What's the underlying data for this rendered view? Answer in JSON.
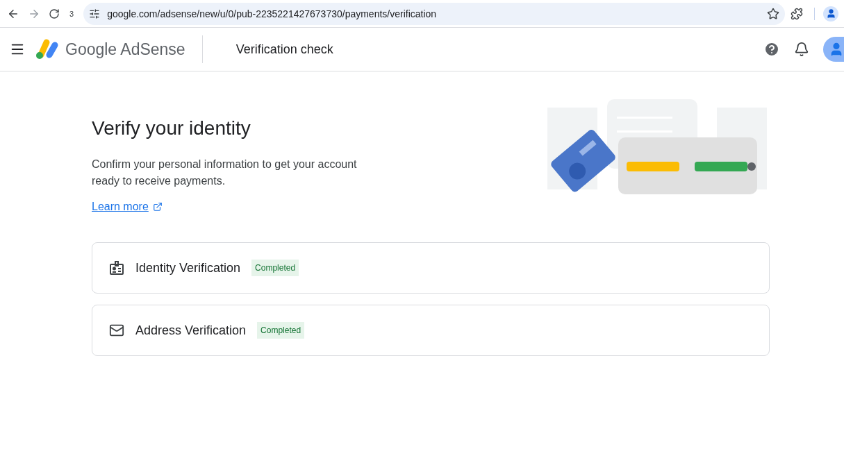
{
  "browser": {
    "tab_count": "3",
    "url": "google.com/adsense/new/u/0/pub-2235221427673730/payments/verification"
  },
  "header": {
    "product": "Google AdSense",
    "page_title": "Verification check"
  },
  "intro": {
    "title": "Verify your identity",
    "description": "Confirm your personal information to get your account ready to receive payments.",
    "link": "Learn more"
  },
  "checks": [
    {
      "kind": "identity",
      "label": "Identity Verification",
      "status": "Completed"
    },
    {
      "kind": "mail",
      "label": "Address Verification",
      "status": "Completed"
    }
  ]
}
